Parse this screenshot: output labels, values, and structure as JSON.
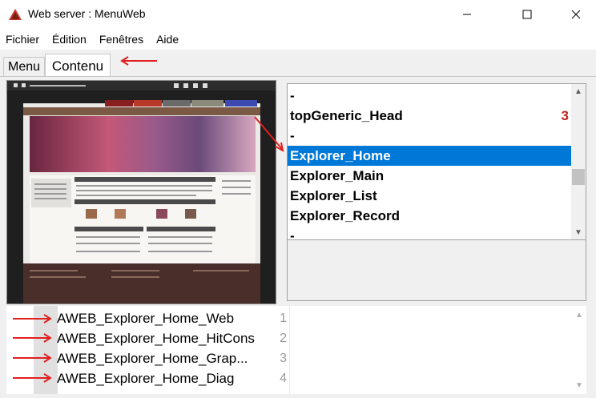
{
  "window": {
    "title": "Web server : MenuWeb",
    "controls": {
      "minimize_icon": "minimize-icon",
      "maximize_icon": "maximize-icon",
      "close_icon": "close-icon"
    }
  },
  "menubar": {
    "items": [
      {
        "label": "Fichier"
      },
      {
        "label": "Édition"
      },
      {
        "label": "Fenêtres"
      },
      {
        "label": "Aide"
      }
    ]
  },
  "tabs": [
    {
      "label": "Menu",
      "active": false
    },
    {
      "label": "Contenu",
      "active": true
    }
  ],
  "right_list": {
    "rows": [
      {
        "label": "-",
        "badge": ""
      },
      {
        "label": "topGeneric_Head",
        "badge": "3"
      },
      {
        "label": "-",
        "badge": ""
      },
      {
        "label": "Explorer_Home",
        "badge": "",
        "selected": true
      },
      {
        "label": "Explorer_Main",
        "badge": ""
      },
      {
        "label": "Explorer_List",
        "badge": ""
      },
      {
        "label": "Explorer_Record",
        "badge": ""
      },
      {
        "label": "-",
        "badge": ""
      }
    ]
  },
  "bottom_list": {
    "rows": [
      {
        "label": "AWEB_Explorer_Home_Web",
        "num": "1"
      },
      {
        "label": "AWEB_Explorer_Home_HitCons",
        "num": "2"
      },
      {
        "label": "AWEB_Explorer_Home_Grap...",
        "num": "3"
      },
      {
        "label": "AWEB_Explorer_Home_Diag",
        "num": "4"
      }
    ]
  },
  "colors": {
    "selection": "#0078d7",
    "badge": "#c0201b",
    "annotation_arrow": "#e02020"
  }
}
